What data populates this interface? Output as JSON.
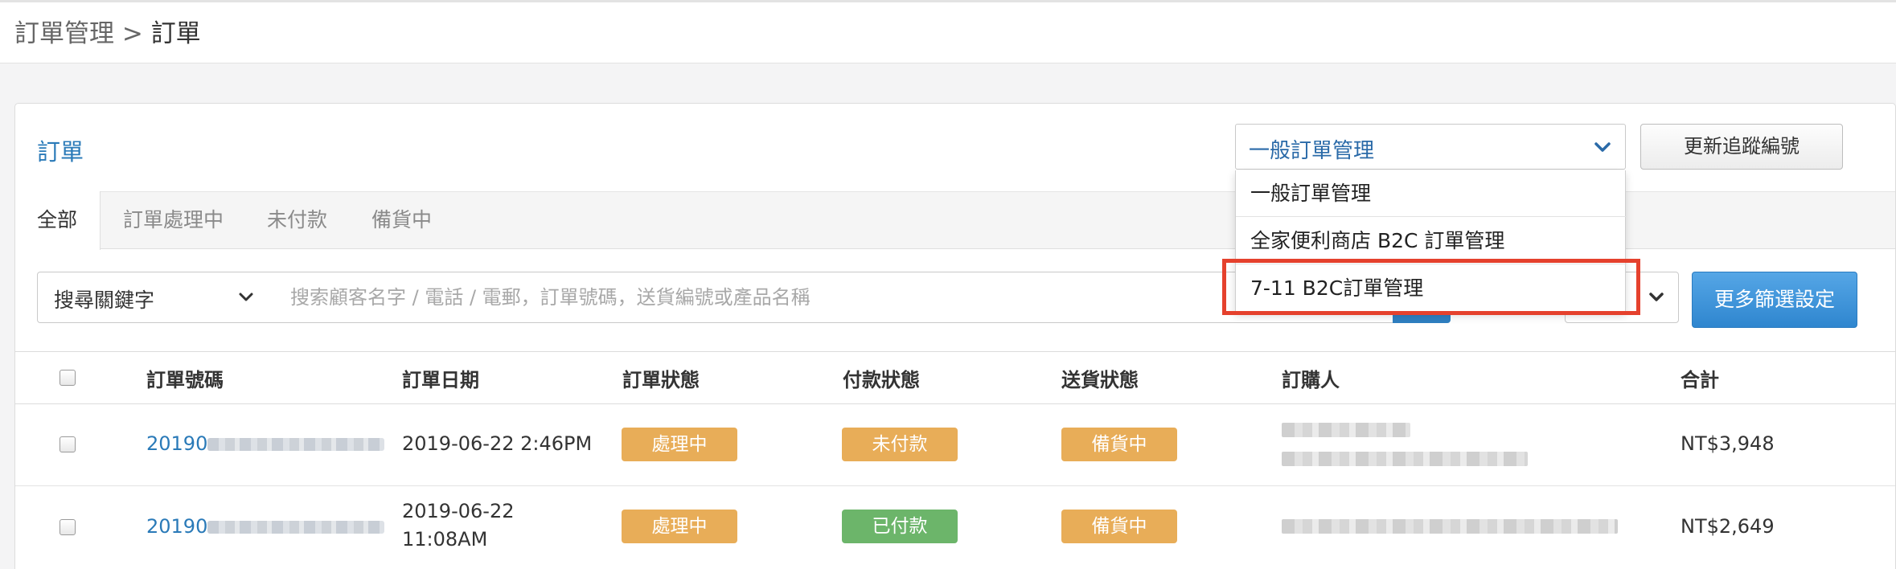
{
  "breadcrumb": {
    "parent": "訂單管理",
    "separator": " > ",
    "current": "訂單"
  },
  "card": {
    "title": "訂單",
    "manager_select": {
      "value": "一般訂單管理",
      "options": [
        "一般訂單管理",
        "全家便利商店 B2C 訂單管理",
        "7-11 B2C訂單管理"
      ]
    },
    "update_button": "更新追蹤編號"
  },
  "tabs": [
    "全部",
    "訂單處理中",
    "未付款",
    "備貨中"
  ],
  "search": {
    "type_label": "搜尋關鍵字",
    "placeholder": "搜索顧客名字 / 電話 / 電郵，訂單號碼，送貨編號或產品名稱",
    "sort_visible_text": "",
    "filter_button": "更多篩選設定"
  },
  "table": {
    "headers": [
      "訂單號碼",
      "訂單日期",
      "訂單狀態",
      "付款狀態",
      "送貨狀態",
      "訂購人",
      "合計"
    ],
    "rows": [
      {
        "order_no": "20190",
        "date": "2019-06-22 2:46PM",
        "order_status": "處理中",
        "payment_status": "未付款",
        "delivery_status": "備貨中",
        "total": "NT$3,948"
      },
      {
        "order_no": "20190",
        "date_line1": "2019-06-22",
        "date_line2": "11:08AM",
        "order_status": "處理中",
        "payment_status": "已付款",
        "delivery_status": "備貨中",
        "total": "NT$2,649"
      }
    ]
  },
  "colors": {
    "accent": "#2a7ab8",
    "orange_badge": "#e8ad58",
    "green_badge": "#6cb56a",
    "highlight": "#e5412d"
  }
}
